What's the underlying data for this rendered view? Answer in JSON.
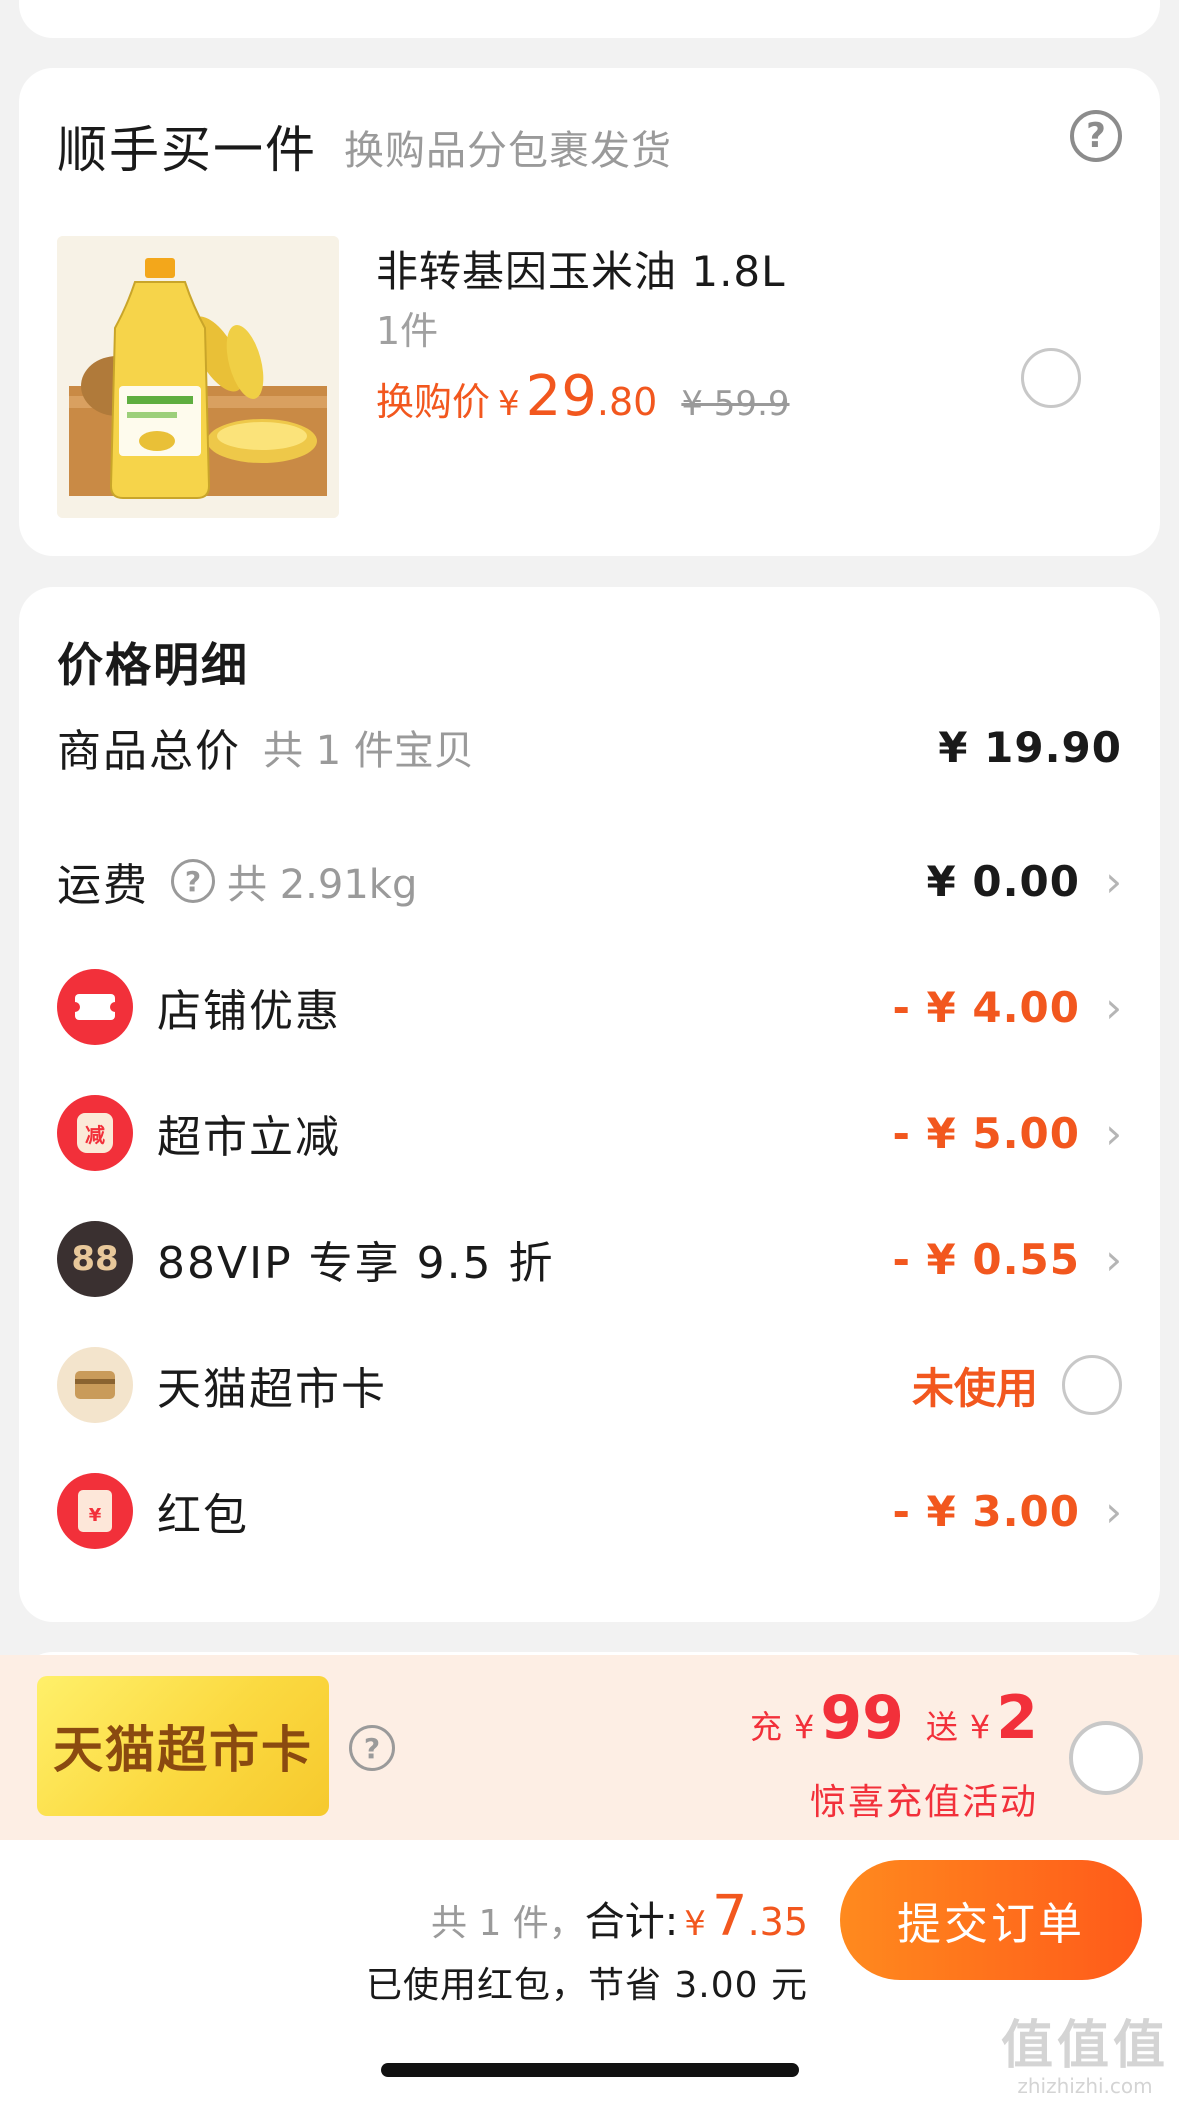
{
  "addon": {
    "title": "顺手买一件",
    "subtitle": "换购品分包裹发货",
    "help_icon": "question-circle-icon",
    "product": {
      "name": "非转基因玉米油 1.8L",
      "quantity": "1件",
      "price_label": "换购价",
      "currency": "¥",
      "price_int": "29",
      "price_dec": ".80",
      "original_price": "¥ 59.9",
      "selected": false
    }
  },
  "price_details": {
    "title": "价格明细",
    "items_total": {
      "label": "商品总价",
      "sub": "共 1 件宝贝",
      "value": "¥ 19.90"
    },
    "shipping": {
      "label": "运费",
      "sub": "共 2.91kg",
      "value": "¥ 0.00"
    },
    "discounts": [
      {
        "label": "店铺优惠",
        "value": "- ¥ 4.00",
        "icon": "ticket-icon"
      },
      {
        "label": "超市立减",
        "value": "- ¥ 5.00",
        "icon": "jar-icon",
        "icon_text": "减"
      },
      {
        "label": "88VIP 专享 9.5 折",
        "value": "- ¥ 0.55",
        "icon": "vip88-icon",
        "icon_text": "88"
      }
    ],
    "tmall_card": {
      "label": "天猫超市卡",
      "status": "未使用",
      "icon": "card-icon",
      "selected": false
    },
    "red_packet": {
      "label": "红包",
      "value": "- ¥ 3.00",
      "icon": "red-envelope-icon",
      "icon_text": "¥"
    },
    "chevron": "›",
    "help_icon": "?"
  },
  "promo": {
    "badge": "天猫超市卡",
    "help": "?",
    "recharge_label": "充",
    "currency": "¥",
    "recharge_amount": "99",
    "bonus_label": "送",
    "bonus_amount": "2",
    "caption": "惊喜充值活动",
    "selected": false
  },
  "footer": {
    "count": "共 1 件，",
    "total_label": "合计:",
    "currency": "¥",
    "total_int": "7",
    "total_dec": ".35",
    "savings": "已使用红包，节省 3.00 元",
    "submit_label": "提交订单"
  },
  "watermark": {
    "logo": "值值值",
    "url": "zhizhizhi.com"
  },
  "colors": {
    "accent_orange": "#f2571e",
    "red": "#f2303a",
    "background": "#f2f2f2",
    "submit_gradient": [
      "#ff8a1e",
      "#ff5a1a"
    ]
  }
}
